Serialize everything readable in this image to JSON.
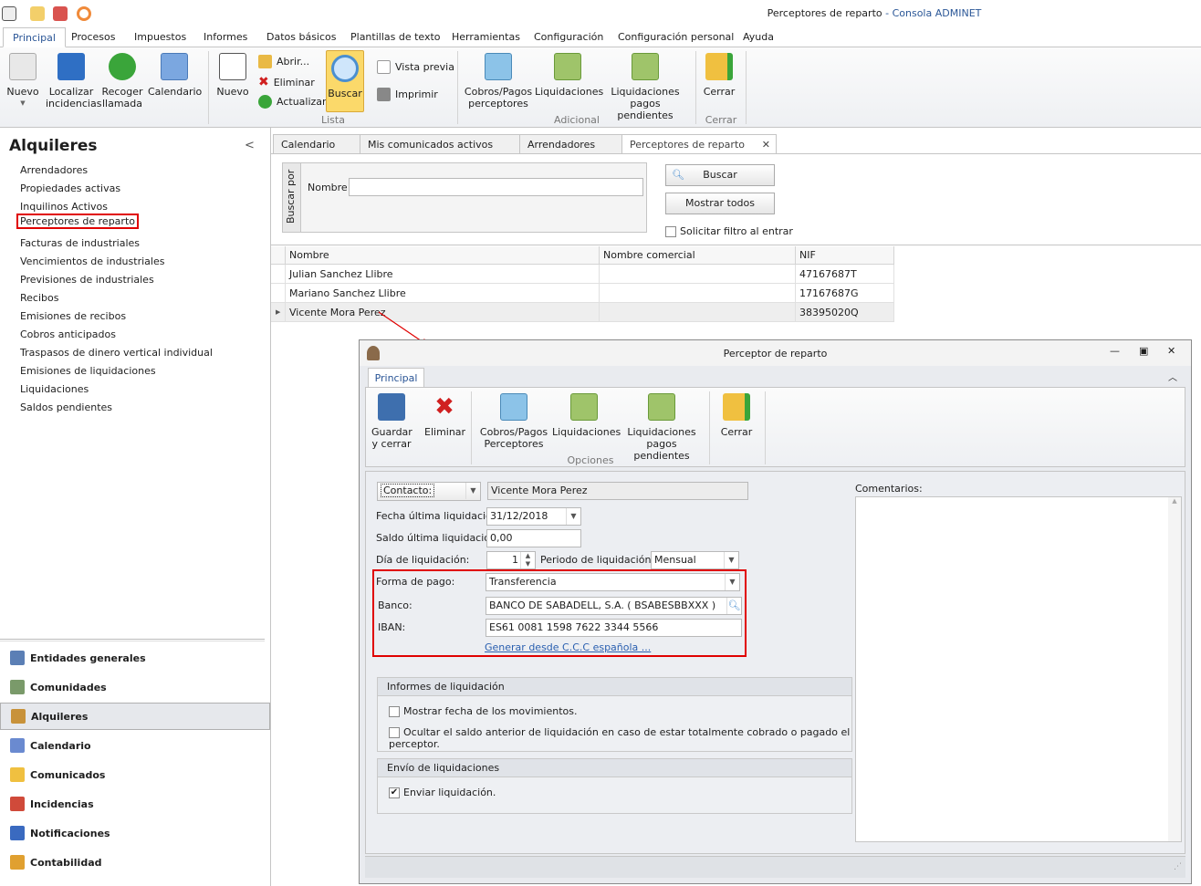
{
  "window": {
    "title": "Perceptores de reparto",
    "app": "Consola ADMINET",
    "separator": " - "
  },
  "ribbon_tabs": [
    "Principal",
    "Procesos",
    "Impuestos",
    "Informes",
    "Datos básicos",
    "Plantillas de texto",
    "Herramientas",
    "Configuración",
    "Configuración personal",
    "Ayuda"
  ],
  "ribbon": {
    "nuevo": "Nuevo",
    "localizar": "Localizar incidencias",
    "recoger": "Recoger llamada",
    "calendario": "Calendario",
    "nuevo2": "Nuevo",
    "abrir": "Abrir...",
    "eliminar": "Eliminar",
    "actualizar": "Actualizar",
    "buscar": "Buscar",
    "vista_previa": "Vista previa",
    "imprimir": "Imprimir",
    "lista": "Lista",
    "cobros": "Cobros/Pagos perceptores",
    "liquidaciones": "Liquidaciones",
    "liq_pend": "Liquidaciones pagos pendientes",
    "adicional": "Adicional",
    "cerrar": "Cerrar",
    "cerrar_group": "Cerrar"
  },
  "sidebar": {
    "header": "Alquileres",
    "collapse": "<",
    "items": [
      "Arrendadores",
      "Propiedades activas",
      "Inquilinos Activos",
      "Perceptores de reparto",
      "Facturas de industriales",
      "Vencimientos de industriales",
      "Previsiones de industriales",
      "Recibos",
      "Emisiones de recibos",
      "Cobros anticipados",
      "Traspasos de dinero vertical individual",
      "Emisiones de liquidaciones",
      "Liquidaciones",
      "Saldos pendientes"
    ],
    "nav": [
      "Entidades generales",
      "Comunidades",
      "Alquileres",
      "Calendario",
      "Comunicados",
      "Incidencias",
      "Notificaciones",
      "Contabilidad"
    ]
  },
  "doc_tabs": [
    "Calendario",
    "Mis comunicados activos",
    "Arrendadores",
    "Perceptores de reparto"
  ],
  "search": {
    "side_label": "Buscar por",
    "nombre_label": "Nombre:",
    "nombre_value": "",
    "buscar": "Buscar",
    "mostrar_todos": "Mostrar todos",
    "solicitar": "Solicitar filtro al entrar"
  },
  "grid": {
    "columns": [
      "Nombre",
      "Nombre comercial",
      "NIF"
    ],
    "rows": [
      [
        "Julian Sanchez Llibre",
        "",
        "47167687T"
      ],
      [
        "Mariano Sanchez Llibre",
        "",
        "17167687G"
      ],
      [
        "Vicente Mora Perez",
        "",
        "38395020Q"
      ]
    ]
  },
  "dialog": {
    "title": "Perceptor de reparto",
    "tab": "Principal",
    "ribbon": {
      "guardar": "Guardar y cerrar",
      "eliminar": "Eliminar",
      "cobros": "Cobros/Pagos Perceptores",
      "liquidaciones": "Liquidaciones",
      "liq_pend": "Liquidaciones pagos pendientes",
      "cerrar": "Cerrar",
      "opciones": "Opciones"
    },
    "form": {
      "contacto_label": "Contacto:",
      "contacto_value": "Vicente Mora Perez",
      "fecha_label": "Fecha última liquidación:",
      "fecha_value": "31/12/2018",
      "saldo_label": "Saldo última liquidación:",
      "saldo_value": "0,00",
      "dia_label": "Día de liquidación:",
      "dia_value": "1",
      "periodo_label": "Periodo de liquidación:",
      "periodo_value": "Mensual",
      "forma_label": "Forma de pago:",
      "forma_value": "Transferencia",
      "banco_label": "Banco:",
      "banco_value": "BANCO DE SABADELL, S.A. ( BSABESBBXXX )",
      "iban_label": "IBAN:",
      "iban_value": "ES61 0081 1598 7622 3344 5566",
      "generar_link": "Generar desde C.C.C española ...",
      "comentarios_label": "Comentarios:"
    },
    "informes": {
      "title": "Informes de liquidación",
      "opt1": "Mostrar fecha de los movimientos.",
      "opt2": "Ocultar el saldo anterior de liquidación en caso de estar totalmente cobrado o pagado el perceptor.",
      "opt1_checked": false,
      "opt2_checked": false
    },
    "envio": {
      "title": "Envío de liquidaciones",
      "opt1": "Enviar liquidación.",
      "opt1_checked": true
    }
  },
  "colors": {
    "highlight": "#e00000",
    "accent": "#2b5797",
    "buscar_active": "#fbd96a"
  }
}
